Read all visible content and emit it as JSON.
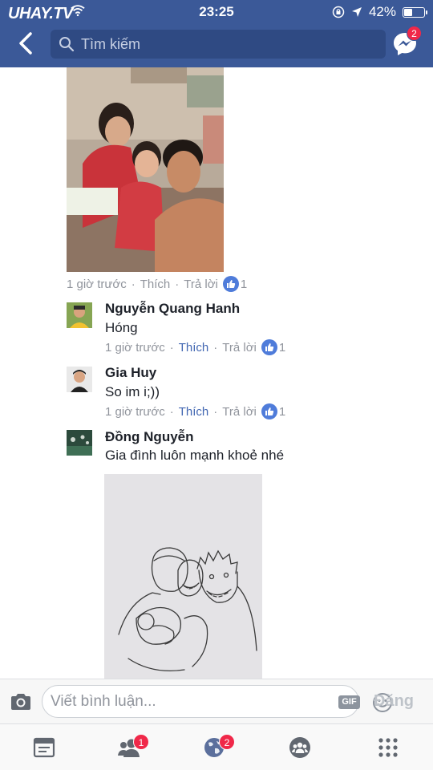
{
  "status_bar": {
    "watermark": "UHAY.TV",
    "time": "23:25",
    "battery": "42%",
    "battery_level": 0.42
  },
  "header": {
    "search_placeholder": "Tìm kiếm",
    "messenger_badge": "2"
  },
  "post_meta": {
    "time": "1 giờ trước",
    "like": "Thích",
    "reply": "Trả lời",
    "like_count": "1"
  },
  "comments": [
    {
      "name": "Nguyễn Quang Hanh",
      "text": "Hóng",
      "time": "1 giờ trước",
      "like": "Thích",
      "reply": "Trả lời",
      "like_count": "1"
    },
    {
      "name": "Gia Huy",
      "text": "So im i;))",
      "time": "1 giờ trước",
      "like": "Thích",
      "reply": "Trả lời",
      "like_count": "1"
    },
    {
      "name": "Đồng Nguyễn",
      "text": "Gia đình luôn mạnh khoẻ nhé"
    }
  ],
  "composer": {
    "placeholder": "Viết bình luận...",
    "gif_label": "GIF",
    "post_label": "Đăng"
  },
  "tab_bar": {
    "friends_badge": "1",
    "notifications_badge": "2"
  },
  "colors": {
    "header": "#3b5998",
    "link": "#4267b2",
    "badge": "#f02849"
  }
}
